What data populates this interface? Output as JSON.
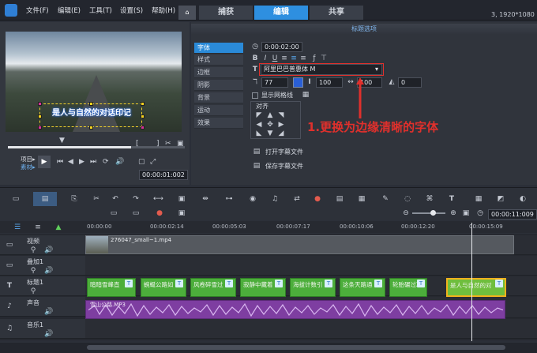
{
  "menu": {
    "file": "文件(F)",
    "edit": "编辑(E)",
    "tools": "工具(T)",
    "settings": "设置(S)",
    "help": "帮助(H)"
  },
  "tabs": [
    "捕获",
    "编辑",
    "共享"
  ],
  "resolution": "3, 1920*1080",
  "preview": {
    "caption": "是人与自然的对话印记",
    "project_label": "项目▸",
    "clip_label": "素材▸",
    "timecode": "00:00:01:002"
  },
  "props": {
    "title": "标题选项",
    "side_tabs": [
      "字体",
      "样式",
      "边框",
      "阴影",
      "背景",
      "运动",
      "效果"
    ],
    "duration": "0:00:02:00",
    "font_name": "阿里巴巴普惠体 M",
    "font_size": "77",
    "line_spacing": "100",
    "char_spacing": "100",
    "rotate": "0",
    "grid_label": "显示网格线",
    "align_label": "对齐",
    "open_file": "打开字幕文件",
    "save_file": "保存字幕文件"
  },
  "annotation": "1.更换为边缘清晰的字体",
  "timeline": {
    "ruler": [
      "00:00:00",
      "00:00:02:14",
      "00:00:05:03",
      "00:00:07:17",
      "00:00:10:06",
      "00:00:12:20",
      "00:00:15:09"
    ],
    "timecode": "00:00:11:009",
    "tracks": [
      {
        "name": "视频"
      },
      {
        "name": "叠加1"
      },
      {
        "name": "标题1"
      },
      {
        "name": "声音"
      },
      {
        "name": "音乐1"
      }
    ],
    "video_clip": "276047_small~1.mp4",
    "audio_clip": "雪山公路.MP3",
    "title_clips": [
      {
        "text": "暗暗雪峰直"
      },
      {
        "text": "蜿蜒公路如"
      },
      {
        "text": "风卷碎雪过"
      },
      {
        "text": "寂静中藏着"
      },
      {
        "text": "海拔计数引"
      },
      {
        "text": "这条天路通"
      },
      {
        "text": "轮胎碾过冰"
      },
      {
        "text": "是人与自然的对"
      }
    ]
  },
  "colors": {
    "accent": "#2e8fe0",
    "title_clip": "#4cae3b",
    "audio_clip": "#7e3ea1",
    "annotation": "#e0302c"
  }
}
